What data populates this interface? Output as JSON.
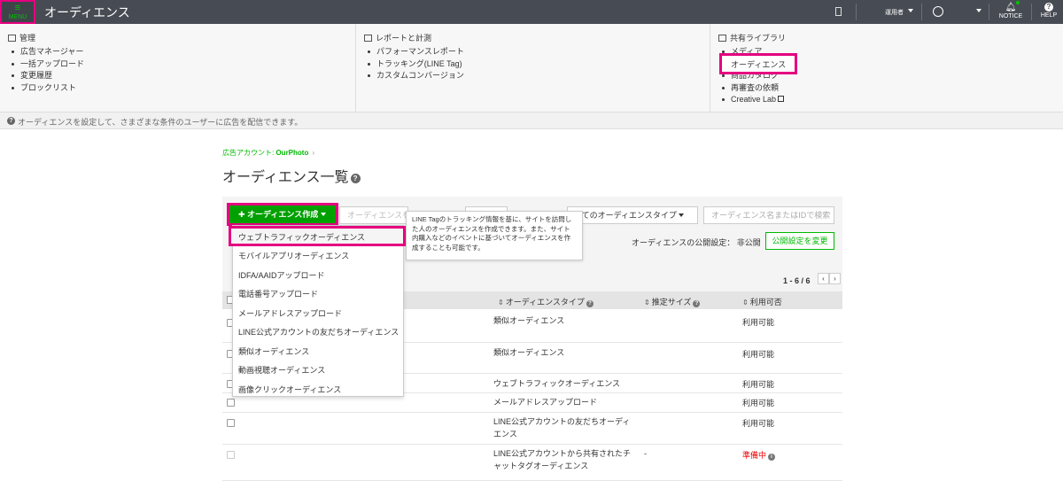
{
  "topbar": {
    "menu_label": "MENU",
    "title": "オーディエンス",
    "user_label": "運用者",
    "notice_label": "NOTICE",
    "help_label": "HELP",
    "accent": "#00c300",
    "highlight": "#e4007f"
  },
  "mega_menu": {
    "management": {
      "heading": "管理",
      "items": [
        "広告マネージャー",
        "一括アップロード",
        "変更履歴",
        "ブロックリスト"
      ]
    },
    "reports": {
      "heading": "レポートと計測",
      "items": [
        "パフォーマンスレポート",
        "トラッキング(LINE Tag)",
        "カスタムコンバージョン"
      ]
    },
    "library": {
      "heading": "共有ライブラリ",
      "items": [
        "メディア",
        "オーディエンス",
        "商品カタログ",
        "再審査の依頼",
        "Creative Lab"
      ]
    }
  },
  "info_text": "オーディエンスを設定して、さまざまな条件のユーザーに広告を配信できます。",
  "breadcrumb": {
    "prefix": "広告アカウント: ",
    "account": "OurPhoto",
    "sep": "›"
  },
  "page_title": "オーディエンス一覧",
  "toolbar": {
    "create_label": "オーディエンス作成",
    "disabled_label": "オーディエンスを",
    "type_filter": "べてのオーディエンスタイプ",
    "search_placeholder": "オーディエンス名またはIDで検索",
    "public_label": "オーディエンスの公開設定： 非公開",
    "public_button": "公開設定を変更"
  },
  "tooltip": "LINE Tagのトラッキング情報を基に、サイトを訪問した人のオーディエンスを作成できます。また、サイト内購入などのイベントに基づいてオーディエンスを作成することも可能です。",
  "dropdown": {
    "items": [
      "ウェブトラフィックオーディエンス",
      "モバイルアプリオーディエンス",
      "IDFA/AAIDアップロード",
      "電話番号アップロード",
      "メールアドレスアップロード",
      "LINE公式アカウントの友だちオーディエンス",
      "類似オーディエンス",
      "動画視聴オーディエンス",
      "画像クリックオーディエンス"
    ]
  },
  "pager": {
    "range": "1 - 6 / 6",
    "prev": "‹",
    "next": "›"
  },
  "table": {
    "headers": {
      "type": "オーディエンスタイプ",
      "size": "推定サイズ",
      "status": "利用可否"
    },
    "rows": [
      {
        "type": "類似オーディエンス",
        "size": "",
        "status": "利用可能"
      },
      {
        "type": "類似オーディエンス",
        "size": "",
        "status": "利用可能"
      },
      {
        "type": "ウェブトラフィックオーディエンス",
        "size": "",
        "status": "利用可能"
      },
      {
        "type": "メールアドレスアップロード",
        "size": "",
        "status": "利用可能"
      },
      {
        "type": "LINE公式アカウントの友だちオーディエンス",
        "size": "",
        "status": "利用可能"
      },
      {
        "type": "LINE公式アカウントから共有されたチャットタグオーディエンス",
        "size": "-",
        "status": "準備中"
      }
    ]
  }
}
